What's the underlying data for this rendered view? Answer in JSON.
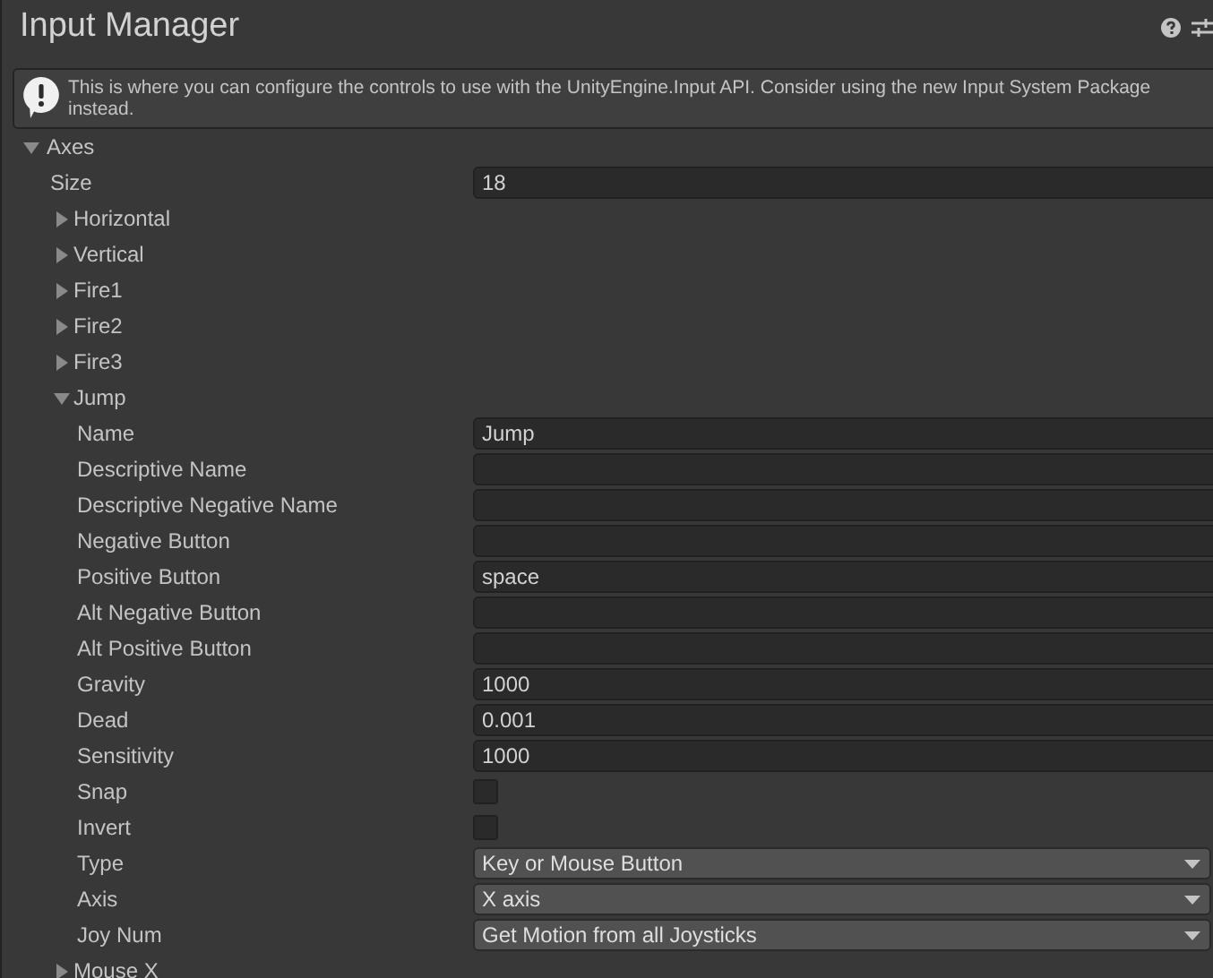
{
  "title": "Input Manager",
  "help_box": {
    "text": "This is where you can configure the controls to use with the UnityEngine.Input API. Consider using the new Input System Package instead."
  },
  "axes": {
    "label": "Axes",
    "expanded": true,
    "size": {
      "label": "Size",
      "value": "18"
    },
    "items": [
      {
        "name": "Horizontal",
        "expanded": false
      },
      {
        "name": "Vertical",
        "expanded": false
      },
      {
        "name": "Fire1",
        "expanded": false
      },
      {
        "name": "Fire2",
        "expanded": false
      },
      {
        "name": "Fire3",
        "expanded": false
      },
      {
        "name": "Jump",
        "expanded": true,
        "fields": [
          {
            "kind": "text",
            "label": "Name",
            "value": "Jump"
          },
          {
            "kind": "text",
            "label": "Descriptive Name"
          },
          {
            "kind": "text",
            "label": "Descriptive Negative Name"
          },
          {
            "kind": "text",
            "label": "Negative Button"
          },
          {
            "kind": "text",
            "label": "Positive Button",
            "value": "space"
          },
          {
            "kind": "text",
            "label": "Alt Negative Button"
          },
          {
            "kind": "text",
            "label": "Alt Positive Button"
          },
          {
            "kind": "text",
            "label": "Gravity",
            "value": "1000"
          },
          {
            "kind": "text",
            "label": "Dead",
            "value": "0.001"
          },
          {
            "kind": "text",
            "label": "Sensitivity",
            "value": "1000"
          },
          {
            "kind": "checkbox",
            "label": "Snap",
            "checked": false
          },
          {
            "kind": "checkbox",
            "label": "Invert",
            "checked": false
          },
          {
            "kind": "dropdown",
            "label": "Type",
            "value": "Key or Mouse Button"
          },
          {
            "kind": "dropdown",
            "label": "Axis",
            "value": "X axis"
          },
          {
            "kind": "dropdown",
            "label": "Joy Num",
            "value": "Get Motion from all Joysticks"
          }
        ]
      },
      {
        "name": "Mouse X",
        "expanded": false
      }
    ]
  }
}
